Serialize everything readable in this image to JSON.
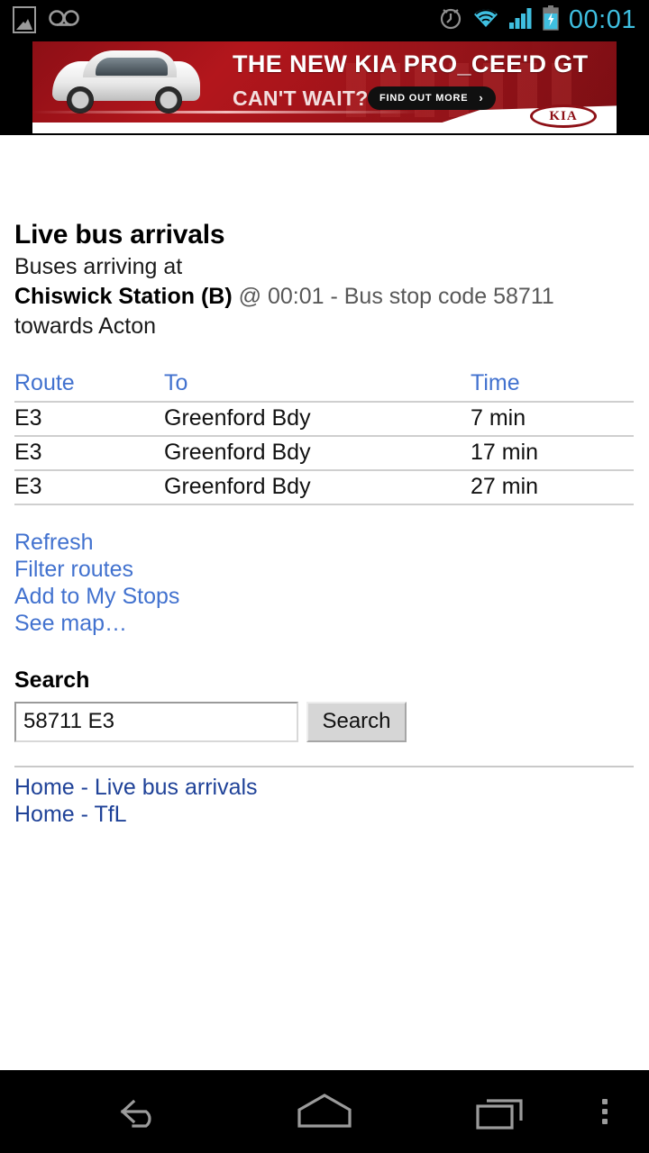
{
  "statusbar": {
    "icons_left": [
      "screenshot-image-icon",
      "voicemail-icon"
    ],
    "icons_right": [
      "alarm-icon",
      "wifi-icon",
      "signal-icon",
      "battery-charging-icon"
    ],
    "clock": "00:01",
    "accent_color": "#3fbfe0"
  },
  "ad": {
    "headline": "THE NEW KIA PRO_CEE'D GT",
    "subhead": "CAN'T WAIT?",
    "cta_label": "FIND OUT MORE",
    "cta_chevron": "›",
    "brand": "KIA",
    "brand_color": "#8d1016",
    "background_color": "#b3161c"
  },
  "page": {
    "title": "Live bus arrivals",
    "subline_prefix": "Buses arriving at",
    "stop_name": "Chiswick Station (B)",
    "stop_meta": " @ 00:01 - Bus stop code 58711",
    "direction": "towards Acton"
  },
  "table": {
    "headers": [
      "Route",
      "To",
      "Time"
    ],
    "rows": [
      {
        "route": "E3",
        "to": "Greenford Bdy",
        "time": "7 min"
      },
      {
        "route": "E3",
        "to": "Greenford Bdy",
        "time": "17 min"
      },
      {
        "route": "E3",
        "to": "Greenford Bdy",
        "time": "27 min"
      }
    ]
  },
  "actions": {
    "link_color": "#4272cf",
    "items": [
      "Refresh",
      "Filter routes",
      "Add to My Stops",
      "See map…"
    ]
  },
  "search": {
    "heading": "Search",
    "value": "58711 E3",
    "placeholder": "",
    "button_label": "Search"
  },
  "footer": {
    "link_color": "#1f4298",
    "items": [
      "Home - Live bus arrivals",
      "Home - TfL"
    ]
  },
  "navbar": {
    "items": [
      "back-icon",
      "home-icon",
      "recents-icon",
      "overflow-menu-icon"
    ]
  }
}
